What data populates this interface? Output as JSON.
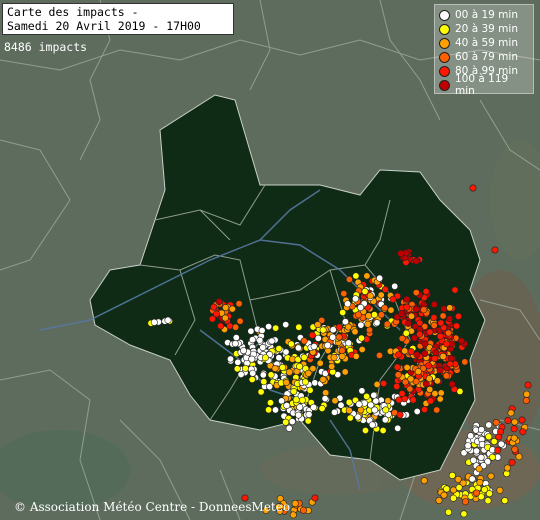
{
  "title": {
    "line1": "Carte des impacts -",
    "line2": "Samedi 20 Avril 2019 - 17H00"
  },
  "impact_count": "8486 impacts",
  "legend": {
    "items": [
      {
        "label": "00 à 19 min",
        "color": "#ffffff"
      },
      {
        "label": "20 à 39 min",
        "color": "#ffff00"
      },
      {
        "label": "40 à 59 min",
        "color": "#ffa000"
      },
      {
        "label": "60 à 79 min",
        "color": "#ff6000"
      },
      {
        "label": "80 à 99 min",
        "color": "#ff1800"
      },
      {
        "label": "100 à 119 min",
        "color": "#c00000"
      }
    ]
  },
  "credit": "© Association Météo Centre - DonneesMeteo",
  "colors": {
    "background_land": "#5a6b5a",
    "region_fill": "#0d2a14",
    "borders": "#b8c0b8",
    "rivers": "#5a7fa8",
    "relief": "#6b5a4a"
  }
}
